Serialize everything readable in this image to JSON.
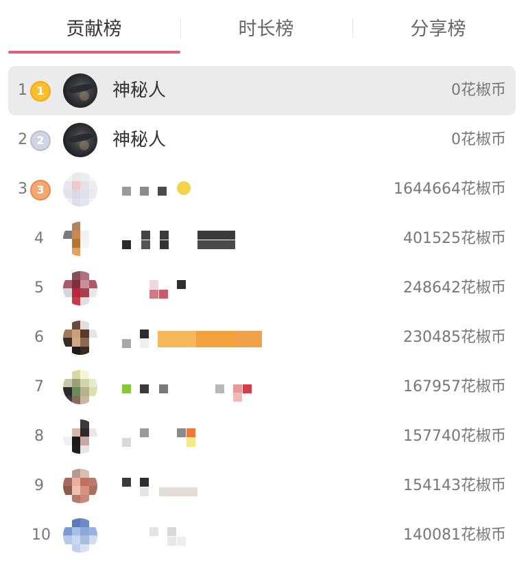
{
  "tabs": [
    {
      "label": "贡献榜",
      "active": true
    },
    {
      "label": "时长榜",
      "active": false
    },
    {
      "label": "分享榜",
      "active": false
    }
  ],
  "accent_color": "#e05f79",
  "currency": "花椒币",
  "rows": [
    {
      "rank": "1",
      "medal": "1",
      "name": "神秘人",
      "coins": "0花椒币"
    },
    {
      "rank": "2",
      "medal": "2",
      "name": "神秘人",
      "coins": "0花椒币"
    },
    {
      "rank": "3",
      "medal": "3",
      "name": "",
      "coins": "1644664花椒币"
    },
    {
      "rank": "4",
      "name": "",
      "coins": "401525花椒币"
    },
    {
      "rank": "5",
      "name": "",
      "coins": "248642花椒币"
    },
    {
      "rank": "6",
      "name": "",
      "coins": "230485花椒币"
    },
    {
      "rank": "7",
      "name": "",
      "coins": "167957花椒币"
    },
    {
      "rank": "8",
      "name": "",
      "coins": "157740花椒币"
    },
    {
      "rank": "9",
      "name": "",
      "coins": "154143花椒币"
    },
    {
      "rank": "10",
      "name": "",
      "coins": "140081花椒币"
    }
  ]
}
